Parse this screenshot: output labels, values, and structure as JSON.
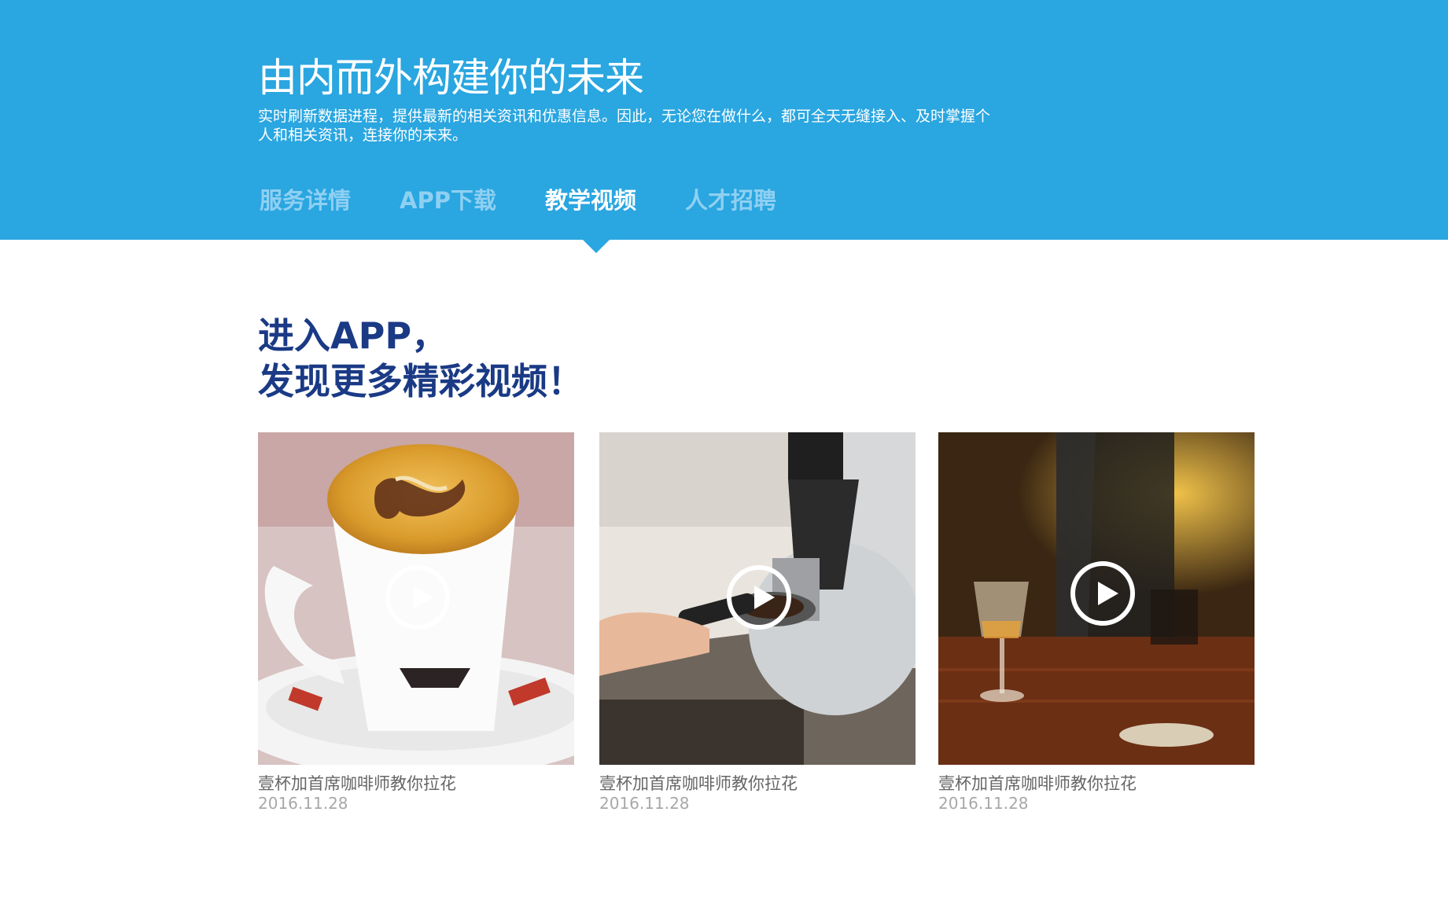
{
  "header": {
    "title": "由内而外构建你的未来",
    "description": "实时刷新数据进程，提供最新的相关资讯和优惠信息。因此，无论您在做什么，都可全天无缝接入、及时掌握个人和相关资讯，连接你的未来。",
    "background_color": "#2aa6e0"
  },
  "nav": {
    "items": [
      {
        "label": "服务详情",
        "active": false
      },
      {
        "label": "APP下载",
        "active": false
      },
      {
        "label": "教学视频",
        "active": true
      },
      {
        "label": "人才招聘",
        "active": false
      }
    ]
  },
  "promo": {
    "line1": "进入APP，",
    "line2": "发现更多精彩视频！",
    "color": "#1a3a85"
  },
  "videos": [
    {
      "title": "壹杯加首席咖啡师教你拉花",
      "date": "2016.11.28",
      "thumbnail": "latte-art-cup",
      "icon": "play-icon"
    },
    {
      "title": "壹杯加首席咖啡师教你拉花",
      "date": "2016.11.28",
      "thumbnail": "espresso-grinder",
      "icon": "play-icon"
    },
    {
      "title": "壹杯加首席咖啡师教你拉花",
      "date": "2016.11.28",
      "thumbnail": "wine-glass-table",
      "icon": "play-icon"
    }
  ]
}
